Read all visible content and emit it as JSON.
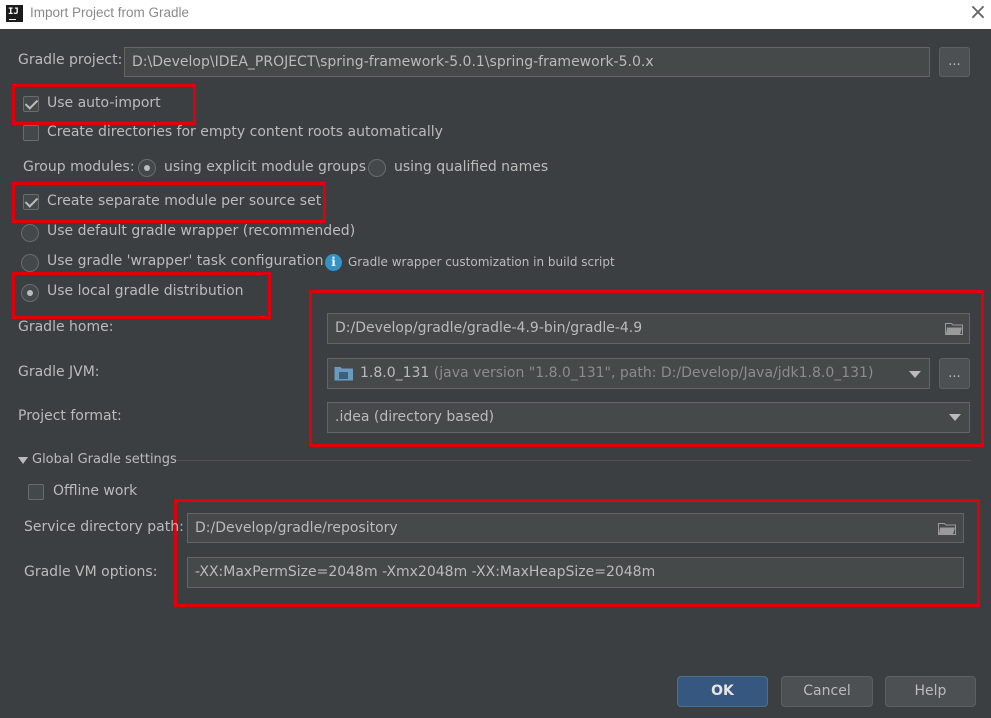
{
  "window": {
    "title": "Import Project from Gradle",
    "icon_text": "IJ"
  },
  "gradle_project": {
    "label": "Gradle project:",
    "value": "D:\\Develop\\IDEA_PROJECT\\spring-framework-5.0.1\\spring-framework-5.0.x",
    "browse_label": "..."
  },
  "options": {
    "auto_import": {
      "label": "Use auto-import",
      "checked": true
    },
    "create_dirs": {
      "label": "Create directories for empty content roots automatically",
      "checked": false
    },
    "group_modules": {
      "label": "Group modules:",
      "explicit_label": "using explicit module groups",
      "qualified_label": "using qualified names",
      "selected": "explicit"
    },
    "separate_module": {
      "label": "Create separate module per source set",
      "checked": true
    }
  },
  "distribution": {
    "default_wrapper": "Use default gradle wrapper (recommended)",
    "wrapper_task": "Use gradle 'wrapper' task configuration",
    "wrapper_info": "Gradle wrapper customization in build script",
    "local": "Use local gradle distribution",
    "selected": "local"
  },
  "gradle_home": {
    "label": "Gradle home:",
    "value": "D:/Develop/gradle/gradle-4.9-bin/gradle-4.9"
  },
  "gradle_jvm": {
    "label": "Gradle JVM:",
    "version": "1.8.0_131",
    "detail": "(java version \"1.8.0_131\", path: D:/Develop/Java/jdk1.8.0_131)",
    "browse_label": "..."
  },
  "project_format": {
    "label": "Project format:",
    "value": ".idea (directory based)"
  },
  "global": {
    "section_label": "Global Gradle settings",
    "offline_work": {
      "label": "Offline work",
      "checked": false
    },
    "service_dir": {
      "label": "Service directory path:",
      "value": "D:/Develop/gradle/repository"
    },
    "vm_options": {
      "label": "Gradle VM options:",
      "value": "-XX:MaxPermSize=2048m -Xmx2048m -XX:MaxHeapSize=2048m"
    }
  },
  "buttons": {
    "ok": "OK",
    "cancel": "Cancel",
    "help": "Help"
  },
  "colors": {
    "background": "#3c3f41",
    "highlight_box": "#e0000c",
    "ok_button": "#365880",
    "text": "#bbbbbb"
  }
}
